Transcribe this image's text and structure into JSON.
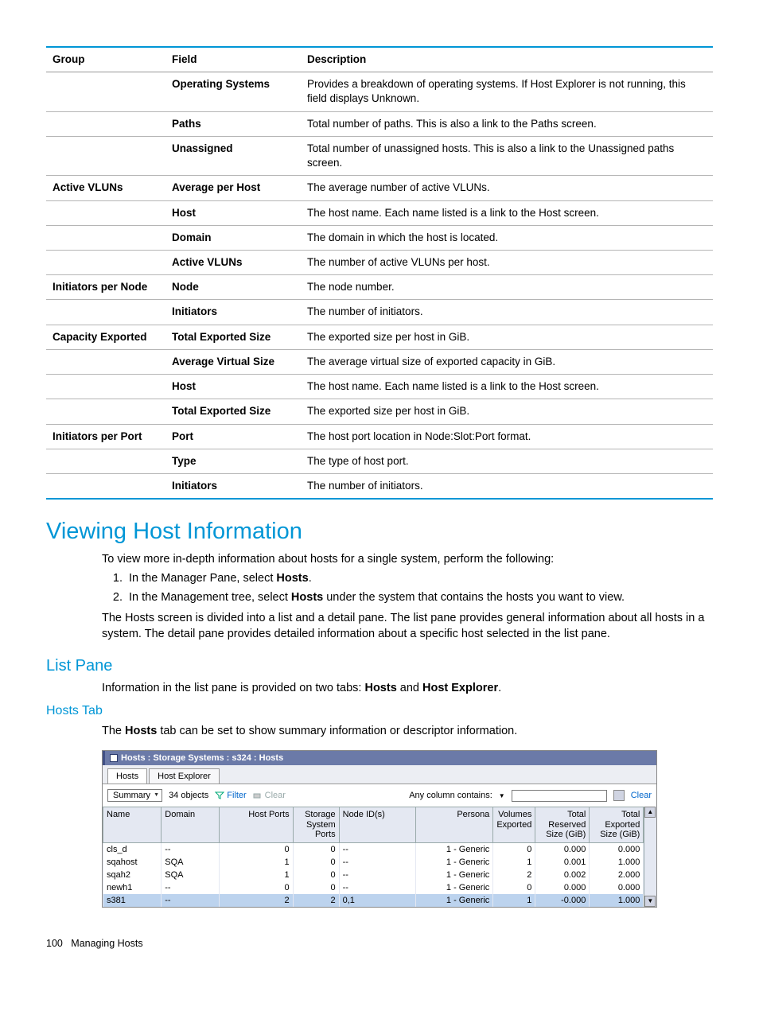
{
  "def_table": {
    "headers": [
      "Group",
      "Field",
      "Description"
    ],
    "rows": [
      {
        "group": "",
        "field": "Operating Systems",
        "desc": "Provides a breakdown of operating systems. If Host Explorer is not running, this field displays Unknown."
      },
      {
        "group": "",
        "field": "Paths",
        "desc": "Total number of paths. This is also a link to the Paths screen."
      },
      {
        "group": "",
        "field": "Unassigned",
        "desc": "Total number of unassigned hosts. This is also a link to the Unassigned paths screen."
      },
      {
        "group": "Active VLUNs",
        "field": "Average per Host",
        "desc": "The average number of active VLUNs."
      },
      {
        "group": "",
        "field": "Host",
        "desc": "The host name. Each name listed is a link to the Host screen."
      },
      {
        "group": "",
        "field": "Domain",
        "desc": "The domain in which the host is located."
      },
      {
        "group": "",
        "field": "Active VLUNs",
        "desc": "The number of active VLUNs per host."
      },
      {
        "group": "Initiators per Node",
        "field": "Node",
        "desc": "The node number."
      },
      {
        "group": "",
        "field": "Initiators",
        "desc": "The number of initiators."
      },
      {
        "group": "Capacity Exported",
        "field": "Total Exported Size",
        "desc": "The exported size per host in GiB."
      },
      {
        "group": "",
        "field": "Average Virtual Size",
        "desc": "The average virtual size of exported capacity in GiB."
      },
      {
        "group": "",
        "field": "Host",
        "desc": "The host name. Each name listed is a link to the Host screen."
      },
      {
        "group": "",
        "field": "Total Exported Size",
        "desc": "The exported size per host in GiB."
      },
      {
        "group": "Initiators per Port",
        "field": "Port",
        "desc": "The host port location in Node:Slot:Port format."
      },
      {
        "group": "",
        "field": "Type",
        "desc": "The type of host port."
      },
      {
        "group": "",
        "field": "Initiators",
        "desc": "The number of initiators."
      }
    ]
  },
  "heading_vhi": "Viewing Host Information",
  "intro_vhi": "To view more in-depth information about hosts for a single system, perform the following:",
  "steps": {
    "s1_a": "In the Manager Pane, select ",
    "s1_b": "Hosts",
    "s1_c": ".",
    "s2_a": "In the Management tree, select ",
    "s2_b": "Hosts",
    "s2_c": " under the system that contains the hosts you want to view."
  },
  "para_divided": "The Hosts screen is divided into a list and a detail pane. The list pane provides general information about all hosts in a system. The detail pane provides detailed information about a specific host selected in the list pane.",
  "heading_listpane": "List Pane",
  "listpane_text_a": "Information in the list pane is provided on two tabs: ",
  "listpane_b1": "Hosts",
  "listpane_mid": " and ",
  "listpane_b2": "Host Explorer",
  "listpane_end": ".",
  "heading_hoststab": "Hosts Tab",
  "hoststab_text_a": "The ",
  "hoststab_b": "Hosts",
  "hoststab_text_b": " tab can be set to show summary information or descriptor information.",
  "figure": {
    "title": "Hosts : Storage Systems : s324 : Hosts",
    "tabs": {
      "hosts": "Hosts",
      "explorer": "Host Explorer"
    },
    "toolbar": {
      "view": "Summary",
      "count": "34 objects",
      "filter": "Filter",
      "clear1": "Clear",
      "any": "Any column contains:",
      "clear2": "Clear"
    },
    "columns": [
      "Name",
      "Domain",
      "Host Ports",
      "Storage System Ports",
      "Node ID(s)",
      "Persona",
      "Volumes Exported",
      "Total Reserved Size (GiB)",
      "Total Exported Size (GiB)"
    ],
    "rows": [
      {
        "name": "cls_d",
        "domain": "--",
        "hp": "0",
        "ssp": "0",
        "nid": "--",
        "persona": "1 - Generic",
        "ve": "0",
        "trs": "0.000",
        "tes": "0.000",
        "sel": false
      },
      {
        "name": "sqahost",
        "domain": "SQA",
        "hp": "1",
        "ssp": "0",
        "nid": "--",
        "persona": "1 - Generic",
        "ve": "1",
        "trs": "0.001",
        "tes": "1.000",
        "sel": false
      },
      {
        "name": "sqah2",
        "domain": "SQA",
        "hp": "1",
        "ssp": "0",
        "nid": "--",
        "persona": "1 - Generic",
        "ve": "2",
        "trs": "0.002",
        "tes": "2.000",
        "sel": false
      },
      {
        "name": "newh1",
        "domain": "--",
        "hp": "0",
        "ssp": "0",
        "nid": "--",
        "persona": "1 - Generic",
        "ve": "0",
        "trs": "0.000",
        "tes": "0.000",
        "sel": false
      },
      {
        "name": "s381",
        "domain": "--",
        "hp": "2",
        "ssp": "2",
        "nid": "0,1",
        "persona": "1 - Generic",
        "ve": "1",
        "trs": "-0.000",
        "tes": "1.000",
        "sel": true
      }
    ]
  },
  "footer_page": "100",
  "footer_label": "Managing Hosts"
}
